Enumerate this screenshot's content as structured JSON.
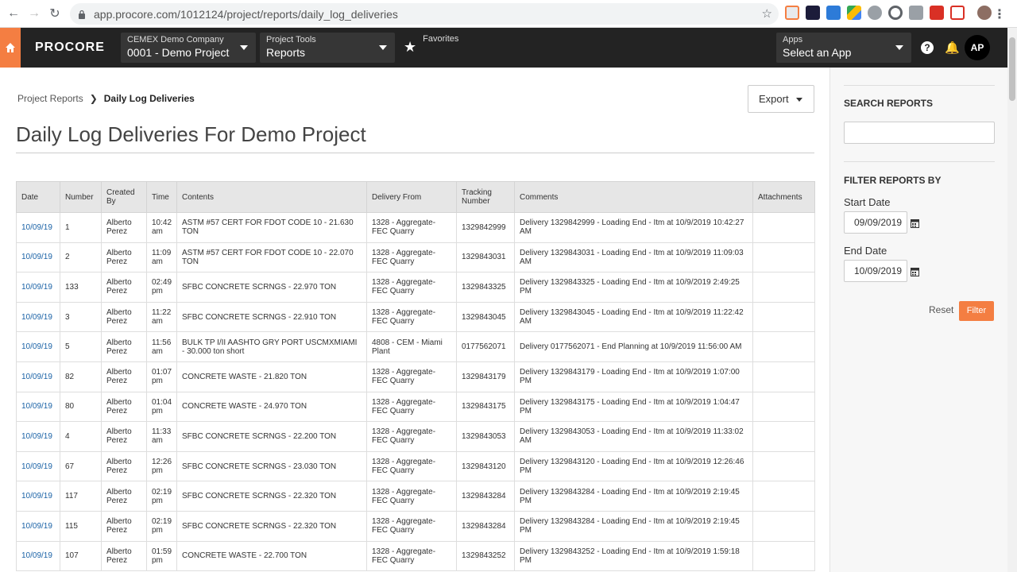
{
  "browser": {
    "url": "app.procore.com/1012124/project/reports/daily_log_deliveries",
    "back_icon": "arrow-left-icon",
    "forward_icon": "arrow-right-icon",
    "reload_icon": "reload-icon"
  },
  "header": {
    "logo": "PROCORE",
    "company_label": "CEMEX Demo Company",
    "project_label": "0001 - Demo Project",
    "tools_label": "Project Tools",
    "tools_value": "Reports",
    "favorites_label": "Favorites",
    "apps_label": "Apps",
    "apps_value": "Select an App",
    "help_glyph": "?",
    "avatar_initials": "AP"
  },
  "breadcrumb": {
    "parent": "Project Reports",
    "current": "Daily Log Deliveries"
  },
  "export_label": "Export",
  "page_title": "Daily Log Deliveries For Demo Project",
  "table": {
    "headers": [
      "Date",
      "Number",
      "Created By",
      "Time",
      "Contents",
      "Delivery From",
      "Tracking Number",
      "Comments",
      "Attachments"
    ],
    "rows": [
      {
        "date": "10/09/19",
        "number": "1",
        "created_by": "Alberto Perez",
        "time": "10:42 am",
        "contents": "ASTM #57 CERT FOR FDOT CODE 10 - 21.630 TON",
        "from": "1328 - Aggregate-FEC Quarry",
        "tracking": "1329842999",
        "comments": "Delivery 1329842999 - Loading End - Itm at 10/9/2019 10:42:27 AM",
        "attachments": ""
      },
      {
        "date": "10/09/19",
        "number": "2",
        "created_by": "Alberto Perez",
        "time": "11:09 am",
        "contents": "ASTM #57 CERT FOR FDOT CODE 10 - 22.070 TON",
        "from": "1328 - Aggregate-FEC Quarry",
        "tracking": "1329843031",
        "comments": "Delivery 1329843031 - Loading End - Itm at 10/9/2019 11:09:03 AM",
        "attachments": ""
      },
      {
        "date": "10/09/19",
        "number": "133",
        "created_by": "Alberto Perez",
        "time": "02:49 pm",
        "contents": "SFBC CONCRETE SCRNGS - 22.970 TON",
        "from": "1328 - Aggregate-FEC Quarry",
        "tracking": "1329843325",
        "comments": "Delivery 1329843325 - Loading End - Itm at 10/9/2019 2:49:25 PM",
        "attachments": ""
      },
      {
        "date": "10/09/19",
        "number": "3",
        "created_by": "Alberto Perez",
        "time": "11:22 am",
        "contents": "SFBC CONCRETE SCRNGS - 22.910 TON",
        "from": "1328 - Aggregate-FEC Quarry",
        "tracking": "1329843045",
        "comments": "Delivery 1329843045 - Loading End - Itm at 10/9/2019 11:22:42 AM",
        "attachments": ""
      },
      {
        "date": "10/09/19",
        "number": "5",
        "created_by": "Alberto Perez",
        "time": "11:56 am",
        "contents": "BULK TP I/II AASHTO GRY PORT USCMXMIAMI - 30.000 ton short",
        "from": "4808 - CEM - Miami Plant",
        "tracking": "0177562071",
        "comments": "Delivery 0177562071 - End Planning at 10/9/2019 11:56:00 AM",
        "attachments": ""
      },
      {
        "date": "10/09/19",
        "number": "82",
        "created_by": "Alberto Perez",
        "time": "01:07 pm",
        "contents": "CONCRETE WASTE - 21.820 TON",
        "from": "1328 - Aggregate-FEC Quarry",
        "tracking": "1329843179",
        "comments": "Delivery 1329843179 - Loading End - Itm at 10/9/2019 1:07:00 PM",
        "attachments": ""
      },
      {
        "date": "10/09/19",
        "number": "80",
        "created_by": "Alberto Perez",
        "time": "01:04 pm",
        "contents": "CONCRETE WASTE - 24.970 TON",
        "from": "1328 - Aggregate-FEC Quarry",
        "tracking": "1329843175",
        "comments": "Delivery 1329843175 - Loading End - Itm at 10/9/2019 1:04:47 PM",
        "attachments": ""
      },
      {
        "date": "10/09/19",
        "number": "4",
        "created_by": "Alberto Perez",
        "time": "11:33 am",
        "contents": "SFBC CONCRETE SCRNGS - 22.200 TON",
        "from": "1328 - Aggregate-FEC Quarry",
        "tracking": "1329843053",
        "comments": "Delivery 1329843053 - Loading End - Itm at 10/9/2019 11:33:02 AM",
        "attachments": ""
      },
      {
        "date": "10/09/19",
        "number": "67",
        "created_by": "Alberto Perez",
        "time": "12:26 pm",
        "contents": "SFBC CONCRETE SCRNGS - 23.030 TON",
        "from": "1328 - Aggregate-FEC Quarry",
        "tracking": "1329843120",
        "comments": "Delivery 1329843120 - Loading End - Itm at 10/9/2019 12:26:46 PM",
        "attachments": ""
      },
      {
        "date": "10/09/19",
        "number": "117",
        "created_by": "Alberto Perez",
        "time": "02:19 pm",
        "contents": "SFBC CONCRETE SCRNGS - 22.320 TON",
        "from": "1328 - Aggregate-FEC Quarry",
        "tracking": "1329843284",
        "comments": "Delivery 1329843284 - Loading End - Itm at 10/9/2019 2:19:45 PM",
        "attachments": ""
      },
      {
        "date": "10/09/19",
        "number": "115",
        "created_by": "Alberto Perez",
        "time": "02:19 pm",
        "contents": "SFBC CONCRETE SCRNGS - 22.320 TON",
        "from": "1328 - Aggregate-FEC Quarry",
        "tracking": "1329843284",
        "comments": "Delivery 1329843284 - Loading End - Itm at 10/9/2019 2:19:45 PM",
        "attachments": ""
      },
      {
        "date": "10/09/19",
        "number": "107",
        "created_by": "Alberto Perez",
        "time": "01:59 pm",
        "contents": "CONCRETE WASTE - 22.700 TON",
        "from": "1328 - Aggregate-FEC Quarry",
        "tracking": "1329843252",
        "comments": "Delivery 1329843252 - Loading End - Itm at 10/9/2019 1:59:18 PM",
        "attachments": ""
      }
    ]
  },
  "sidebar": {
    "search_heading": "SEARCH REPORTS",
    "search_value": "",
    "filter_heading": "FILTER REPORTS BY",
    "start_label": "Start Date",
    "start_value": "09/09/2019",
    "end_label": "End Date",
    "end_value": "10/09/2019",
    "reset_label": "Reset",
    "filter_label": "Filter"
  },
  "colors": {
    "accent": "#f47e42",
    "header_bg": "#232323",
    "link": "#1a62a6"
  }
}
